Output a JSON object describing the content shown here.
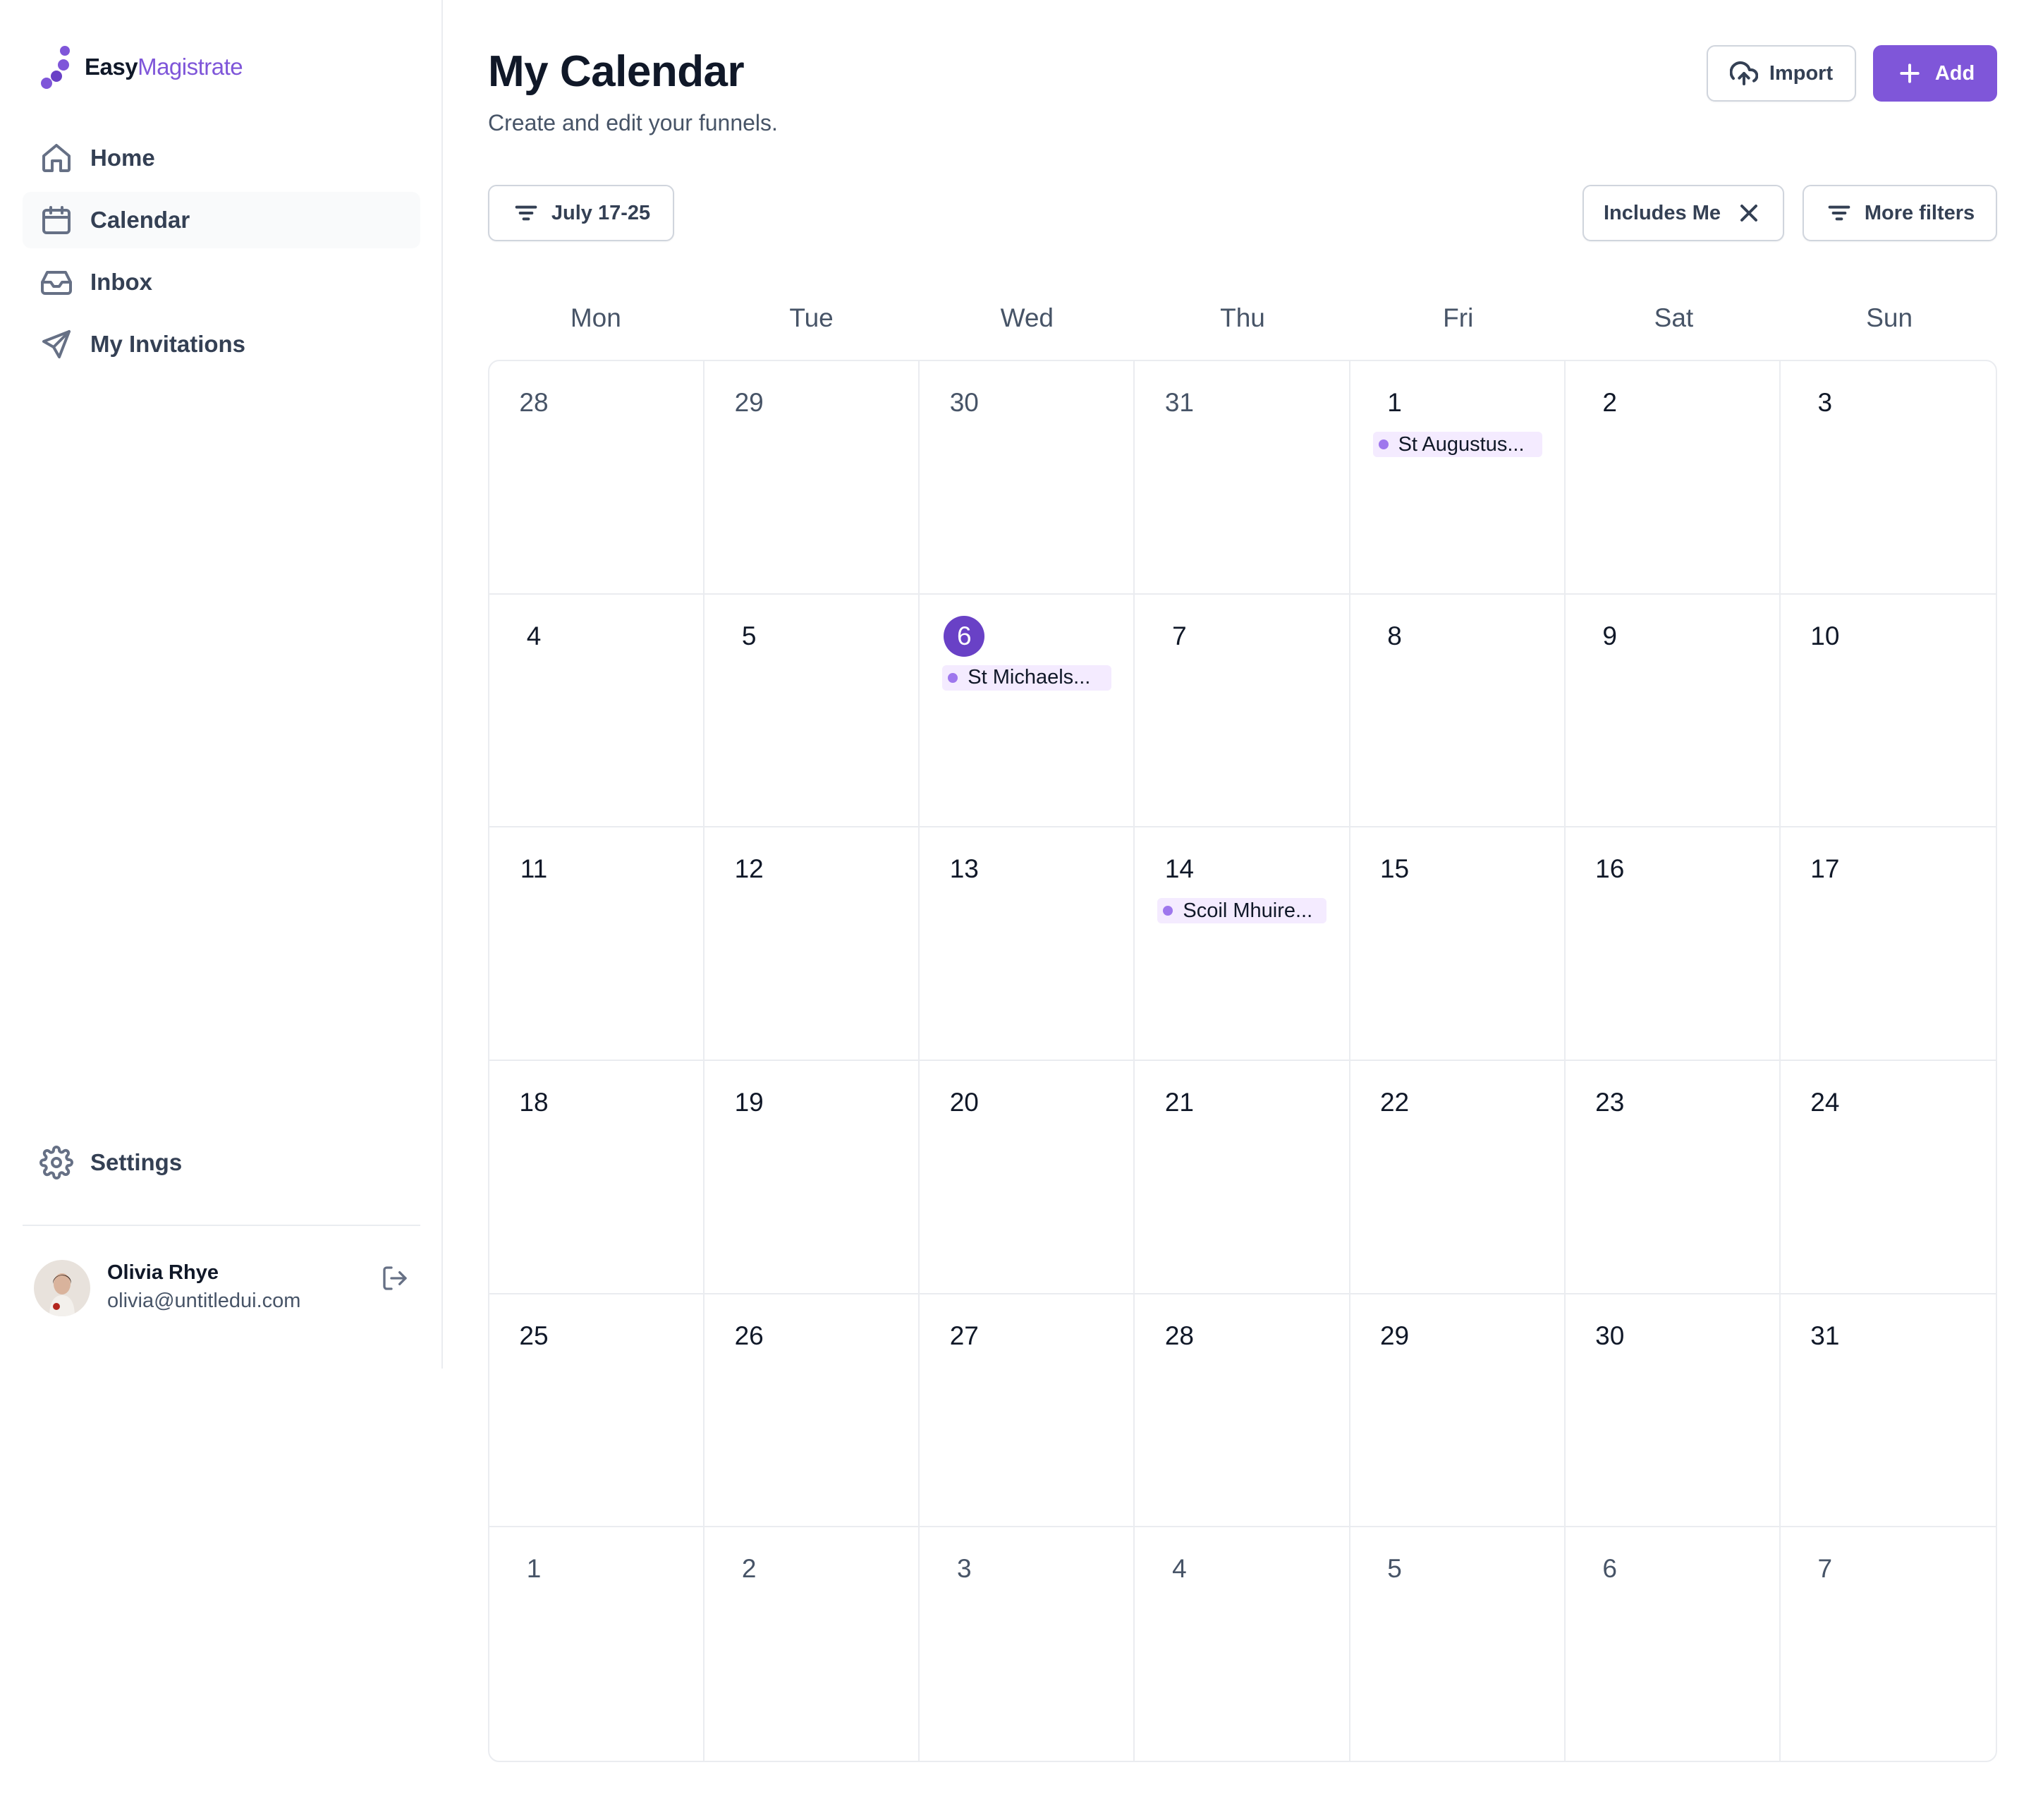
{
  "brand": {
    "name_part1": "Easy",
    "name_part2": "Magistrate",
    "accent": "#7f56d9"
  },
  "sidebar": {
    "items": [
      {
        "label": "Home",
        "icon": "home-icon"
      },
      {
        "label": "Calendar",
        "icon": "calendar-icon",
        "active": true
      },
      {
        "label": "Inbox",
        "icon": "inbox-icon"
      },
      {
        "label": "My Invitations",
        "icon": "send-icon"
      }
    ],
    "settings_label": "Settings",
    "user": {
      "name": "Olivia Rhye",
      "email": "olivia@untitledui.com"
    }
  },
  "header": {
    "title": "My Calendar",
    "subtitle": "Create and edit your funnels.",
    "import_label": "Import",
    "add_label": "Add"
  },
  "filters": {
    "date_range": "July 17-25",
    "includes_me": "Includes Me",
    "more_filters": "More filters"
  },
  "calendar": {
    "weekdays": [
      "Mon",
      "Tue",
      "Wed",
      "Thu",
      "Fri",
      "Sat",
      "Sun"
    ],
    "days": [
      {
        "n": "28",
        "muted": true
      },
      {
        "n": "29",
        "muted": true
      },
      {
        "n": "30",
        "muted": true
      },
      {
        "n": "31",
        "muted": true
      },
      {
        "n": "1",
        "event": "St Augustus..."
      },
      {
        "n": "2"
      },
      {
        "n": "3"
      },
      {
        "n": "4"
      },
      {
        "n": "5"
      },
      {
        "n": "6",
        "today": true,
        "event": "St Michaels..."
      },
      {
        "n": "7"
      },
      {
        "n": "8"
      },
      {
        "n": "9"
      },
      {
        "n": "10"
      },
      {
        "n": "11"
      },
      {
        "n": "12"
      },
      {
        "n": "13"
      },
      {
        "n": "14",
        "event": "Scoil Mhuire..."
      },
      {
        "n": "15"
      },
      {
        "n": "16"
      },
      {
        "n": "17"
      },
      {
        "n": "18"
      },
      {
        "n": "19"
      },
      {
        "n": "20"
      },
      {
        "n": "21"
      },
      {
        "n": "22"
      },
      {
        "n": "23"
      },
      {
        "n": "24"
      },
      {
        "n": "25"
      },
      {
        "n": "26"
      },
      {
        "n": "27"
      },
      {
        "n": "28"
      },
      {
        "n": "29"
      },
      {
        "n": "30"
      },
      {
        "n": "31"
      },
      {
        "n": "1",
        "muted": true
      },
      {
        "n": "2",
        "muted": true
      },
      {
        "n": "3",
        "muted": true
      },
      {
        "n": "4",
        "muted": true
      },
      {
        "n": "5",
        "muted": true
      },
      {
        "n": "6",
        "muted": true
      },
      {
        "n": "7",
        "muted": true
      }
    ],
    "today_color": "#6941c6",
    "event_bg": "#f4ebff",
    "event_dot": "#9e77ed"
  }
}
